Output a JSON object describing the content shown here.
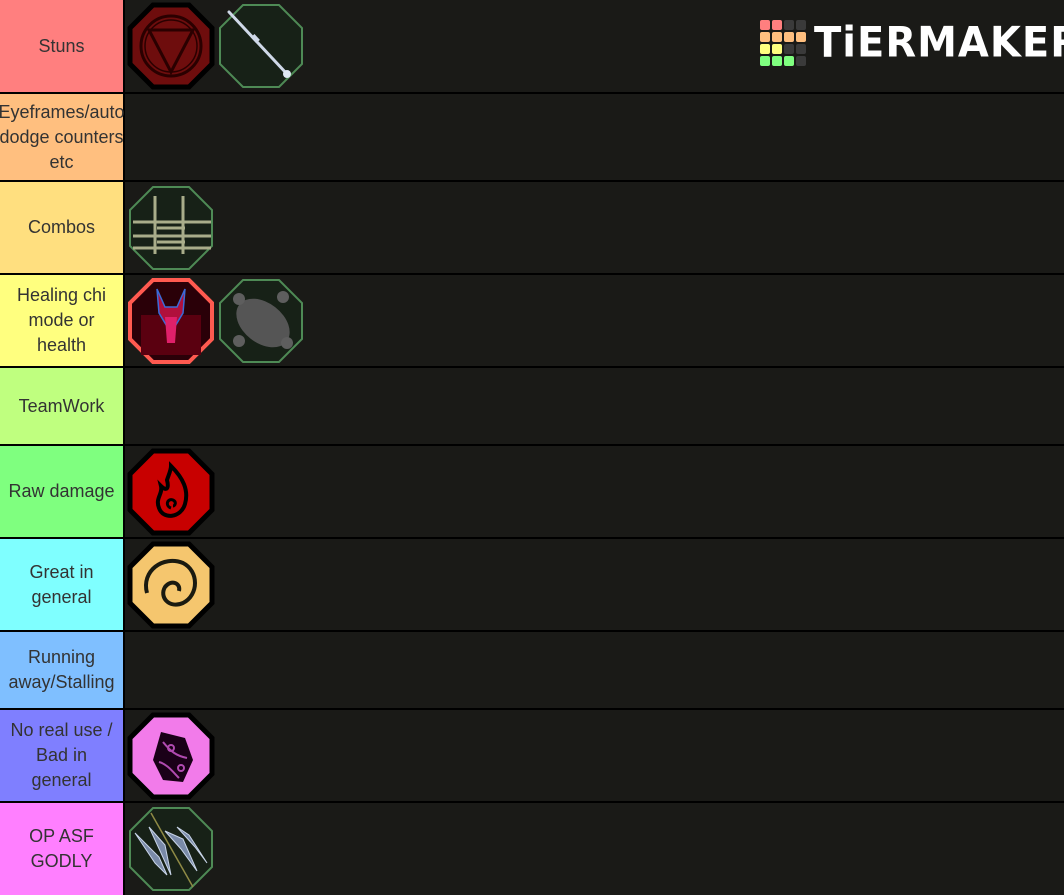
{
  "logo": {
    "text": "TiERMAKER",
    "grid_colors": [
      "#ff7f7f",
      "#ff7f7f",
      "#3a3a3a",
      "#3a3a3a",
      "#ffbf7f",
      "#ffbf7f",
      "#ffbf7f",
      "#ffbf7f",
      "#ffff7f",
      "#ffff7f",
      "#3a3a3a",
      "#3a3a3a",
      "#7fff7f",
      "#7fff7f",
      "#7fff7f",
      "#3a3a3a"
    ]
  },
  "tiers": [
    {
      "label": "Stuns",
      "color": "#ff7f7f",
      "items": [
        "red-triangle-circle-emblem",
        "white-staff-emblem"
      ]
    },
    {
      "label": "Eyeframes/auto dodge counters etc",
      "color": "#ffbf7f",
      "items": []
    },
    {
      "label": "Combos",
      "color": "#ffdf7f",
      "items": [
        "bamboo-cage-emblem"
      ]
    },
    {
      "label": "Healing chi mode or health",
      "color": "#ffff7f",
      "items": [
        "red-demon-avatar-emblem",
        "gray-turtle-emblem"
      ]
    },
    {
      "label": "TeamWork",
      "color": "#bfff7f",
      "items": []
    },
    {
      "label": "Raw damage",
      "color": "#7fff7f",
      "items": [
        "fire-flame-emblem"
      ]
    },
    {
      "label": "Great in general",
      "color": "#7fffff",
      "items": [
        "golden-spiral-emblem"
      ]
    },
    {
      "label": "Running away/Stalling",
      "color": "#7fbfff",
      "items": []
    },
    {
      "label": "No real use / Bad in general",
      "color": "#7f7fff",
      "items": [
        "pink-crystal-emblem"
      ]
    },
    {
      "label": "OP ASF GODLY",
      "color": "#ff7fff",
      "items": [
        "twin-tridents-emblem"
      ]
    }
  ]
}
